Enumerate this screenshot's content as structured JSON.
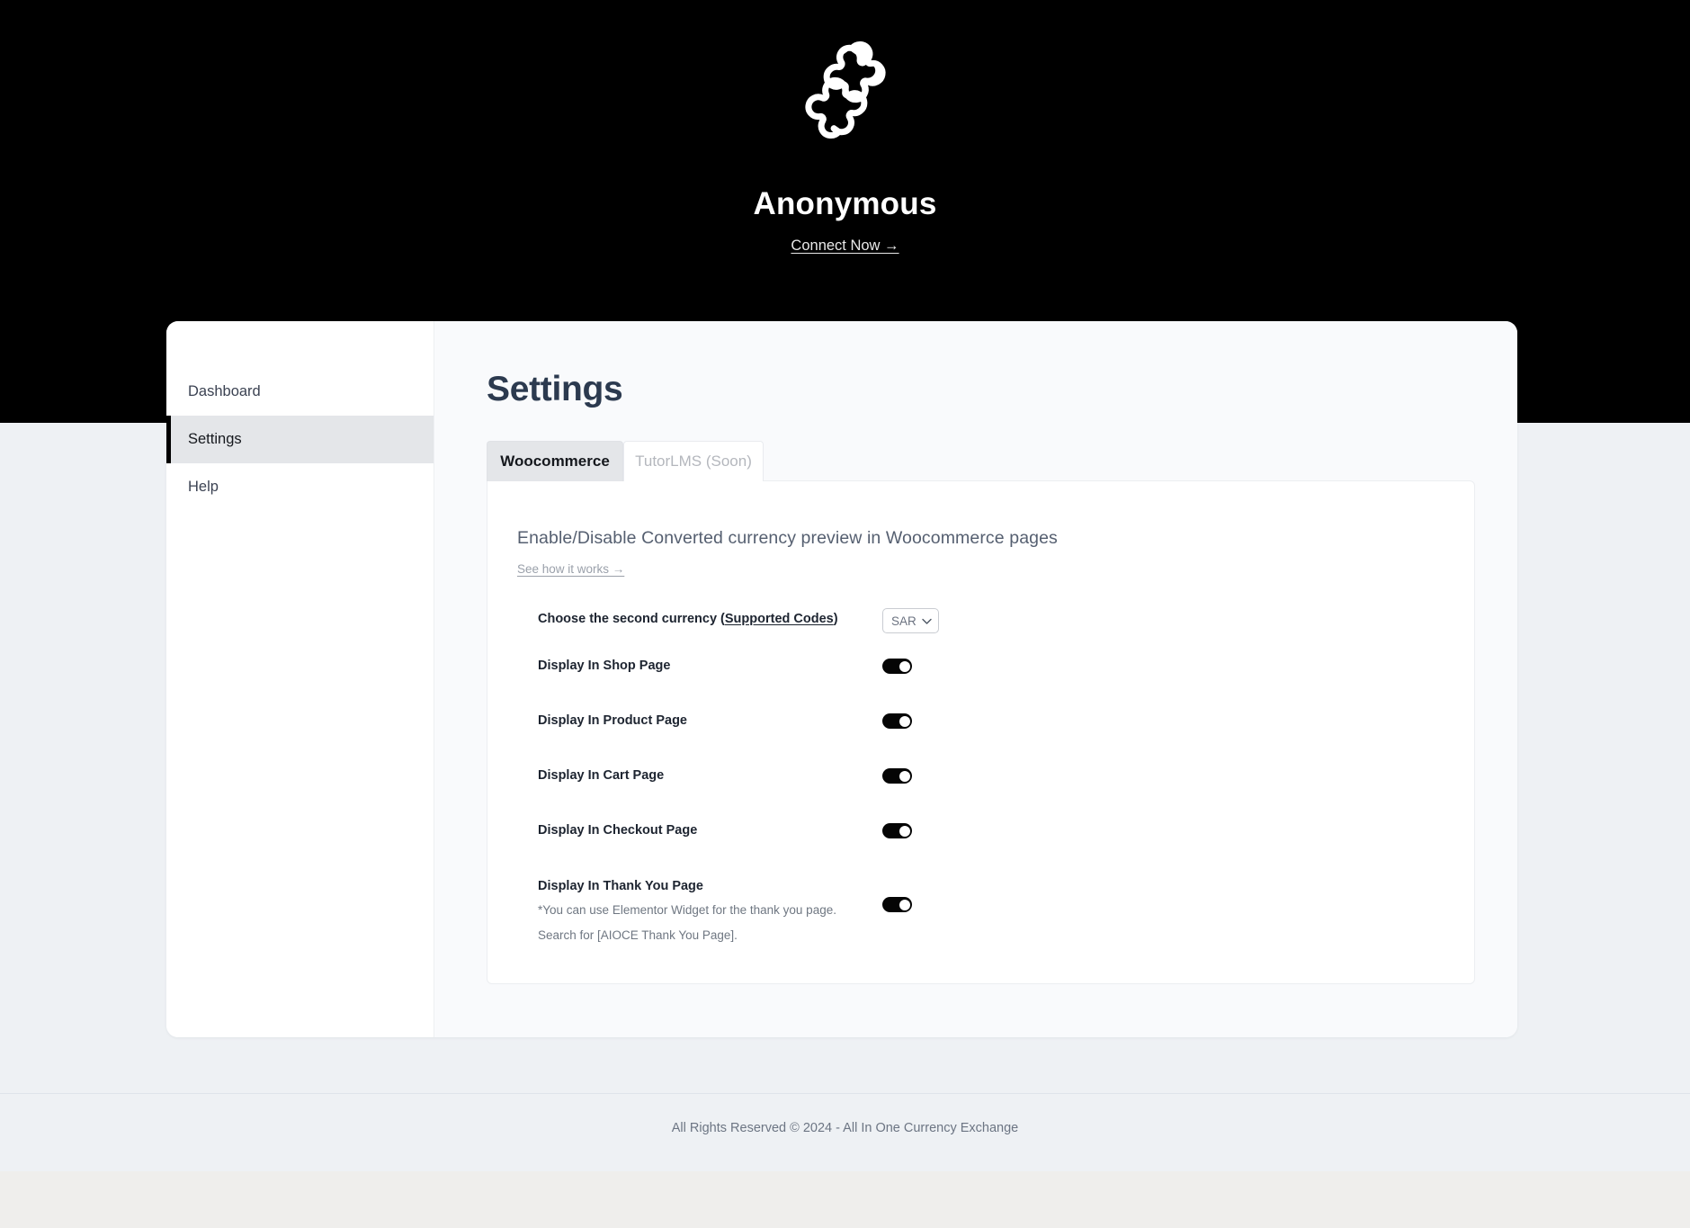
{
  "hero": {
    "logo_icon": "puzzle-piece-icon",
    "title": "Anonymous",
    "connect_link": "Connect Now →"
  },
  "sidebar": {
    "items": [
      {
        "label": "Dashboard",
        "active": false
      },
      {
        "label": "Settings",
        "active": true
      },
      {
        "label": "Help",
        "active": false
      }
    ]
  },
  "main": {
    "page_title": "Settings",
    "tabs": [
      {
        "label": "Woocommerce",
        "active": true
      },
      {
        "label": "TutorLMS (Soon)",
        "active": false
      }
    ],
    "panel": {
      "heading": "Enable/Disable Converted currency preview in Woocommerce pages",
      "sublink": "See how it works →",
      "rows": [
        {
          "label_prefix": "Choose the second currency (",
          "label_link": "Supported Codes",
          "label_suffix": ")",
          "control": "select",
          "value": "SAR",
          "chevron_icon": "chevron-down-icon"
        },
        {
          "label": "Display In Shop Page",
          "control": "toggle",
          "value": "on"
        },
        {
          "label": "Display In Product Page",
          "control": "toggle",
          "value": "on"
        },
        {
          "label": "Display In Cart Page",
          "control": "toggle",
          "value": "on"
        },
        {
          "label": "Display In Checkout Page",
          "control": "toggle",
          "value": "on"
        },
        {
          "label": "Display In Thank You Page",
          "note_line1": "*You can use Elementor Widget for the thank you page.",
          "note_line2": "Search for [AIOCE Thank You Page].",
          "control": "toggle",
          "value": "on"
        }
      ]
    }
  },
  "footer": {
    "text": "All Rights Reserved © 2024 - All In One Currency Exchange"
  },
  "colors": {
    "hero_background": "#000000",
    "page_background": "#eef1f4",
    "card_background": "#f9fafc",
    "sidebar_background": "#ffffff",
    "active_item_background": "#e4e6e9",
    "active_item_bar": "#000000",
    "title_color": "#2c3a4f",
    "toggle_on": "#050505",
    "footer_band": "#efeeec"
  }
}
